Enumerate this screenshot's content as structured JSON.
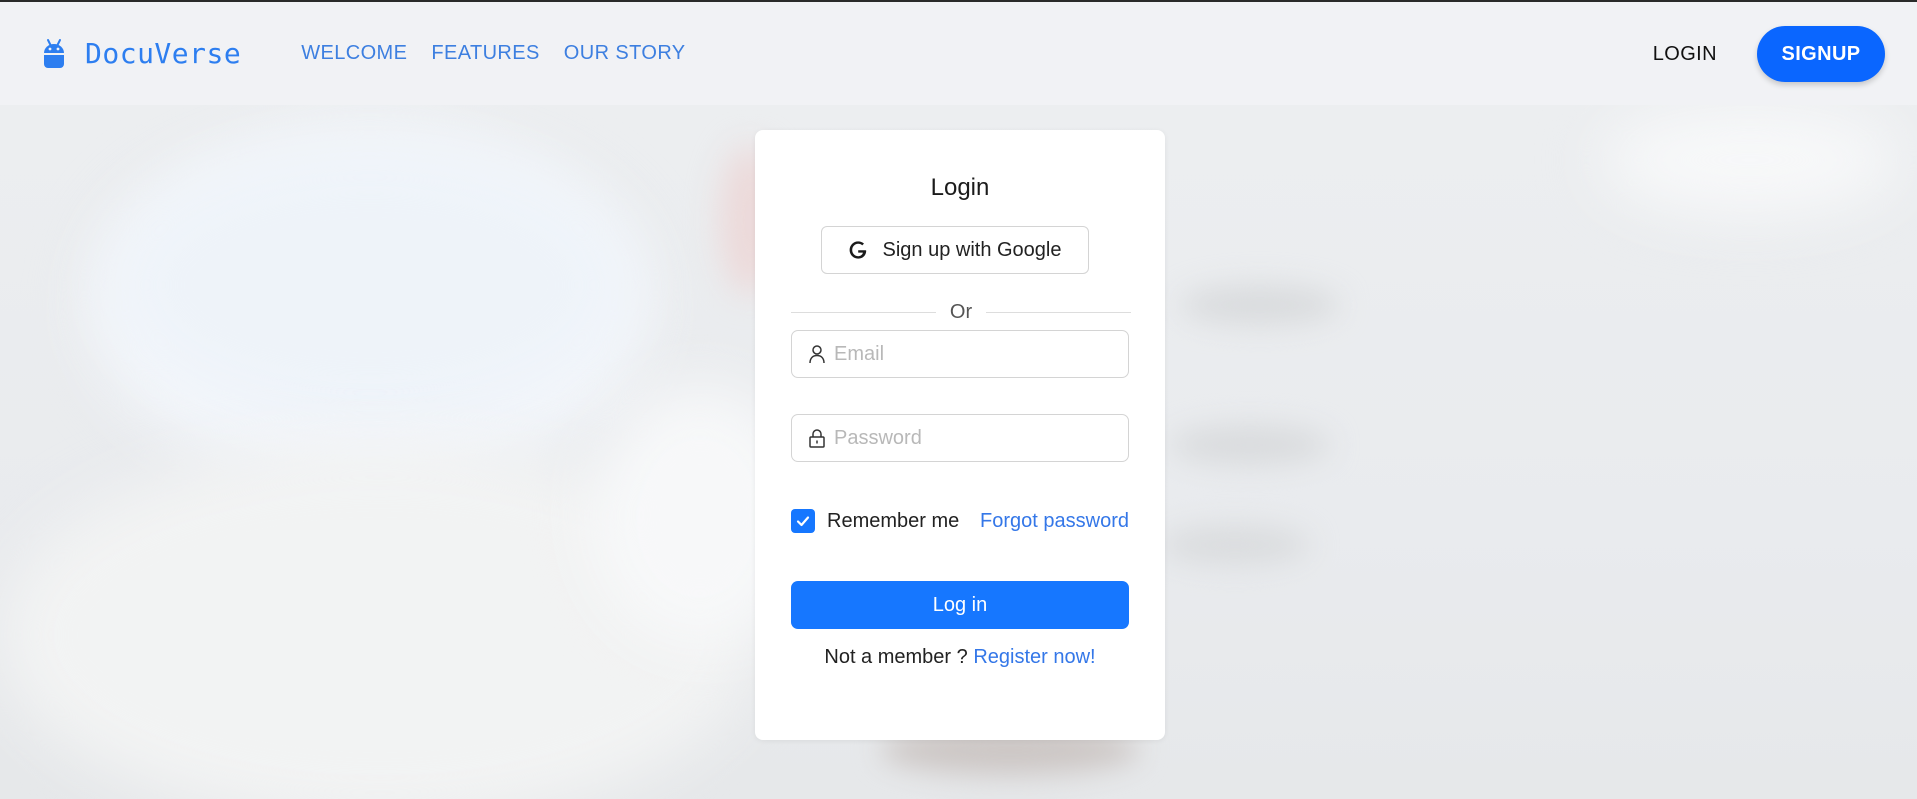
{
  "brand": {
    "name": "DocuVerse",
    "icon": "android-icon",
    "color": "#2d7ef0"
  },
  "nav": {
    "links": [
      "WELCOME",
      "FEATURES",
      "OUR STORY"
    ],
    "login_label": "LOGIN",
    "signup_label": "SIGNUP"
  },
  "login_card": {
    "title": "Login",
    "google_button_label": "Sign up with Google",
    "divider_text": "Or",
    "email_placeholder": "Email",
    "password_placeholder": "Password",
    "remember_label": "Remember me",
    "remember_checked": true,
    "forgot_label": "Forgot password",
    "login_button_label": "Log in",
    "register_prompt": "Not a member ?",
    "register_link": "Register now!"
  },
  "colors": {
    "primary": "#1677ff",
    "link": "#3477e8",
    "nav_link": "#3d7fe0"
  }
}
